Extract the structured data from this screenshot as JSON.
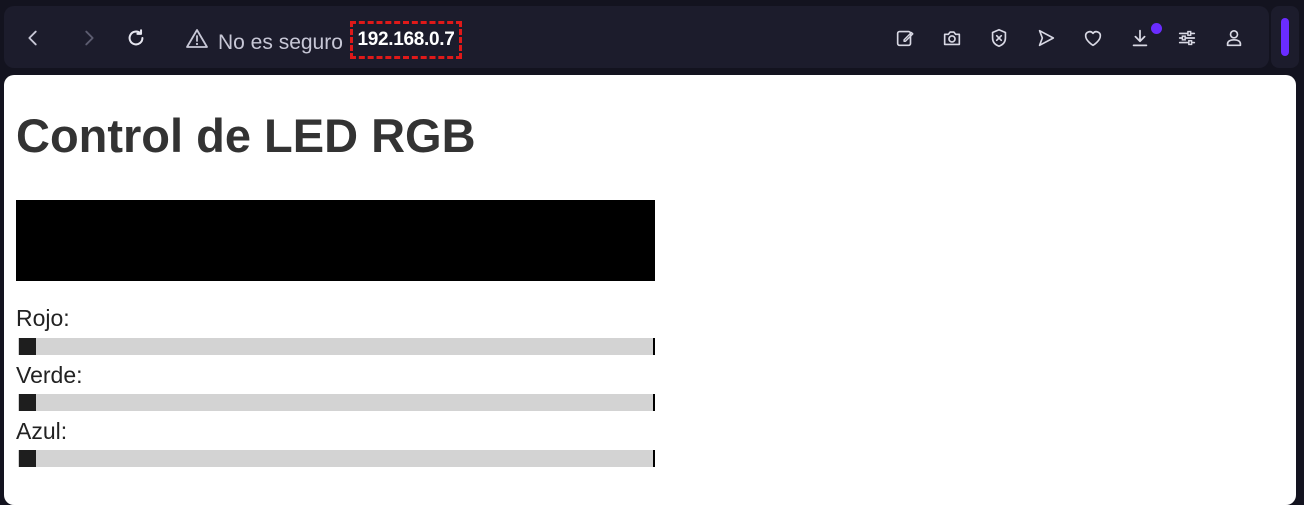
{
  "browser": {
    "security_label": "No es seguro",
    "host": "192.168.0.7"
  },
  "page": {
    "title": "Control de LED RGB",
    "color_preview": "#000000",
    "sliders": [
      {
        "label": "Rojo:",
        "value": 0
      },
      {
        "label": "Verde:",
        "value": 0
      },
      {
        "label": "Azul:",
        "value": 0
      }
    ]
  },
  "colors": {
    "browser_accent": "#6a2cff",
    "highlight_box": "#e01919"
  }
}
